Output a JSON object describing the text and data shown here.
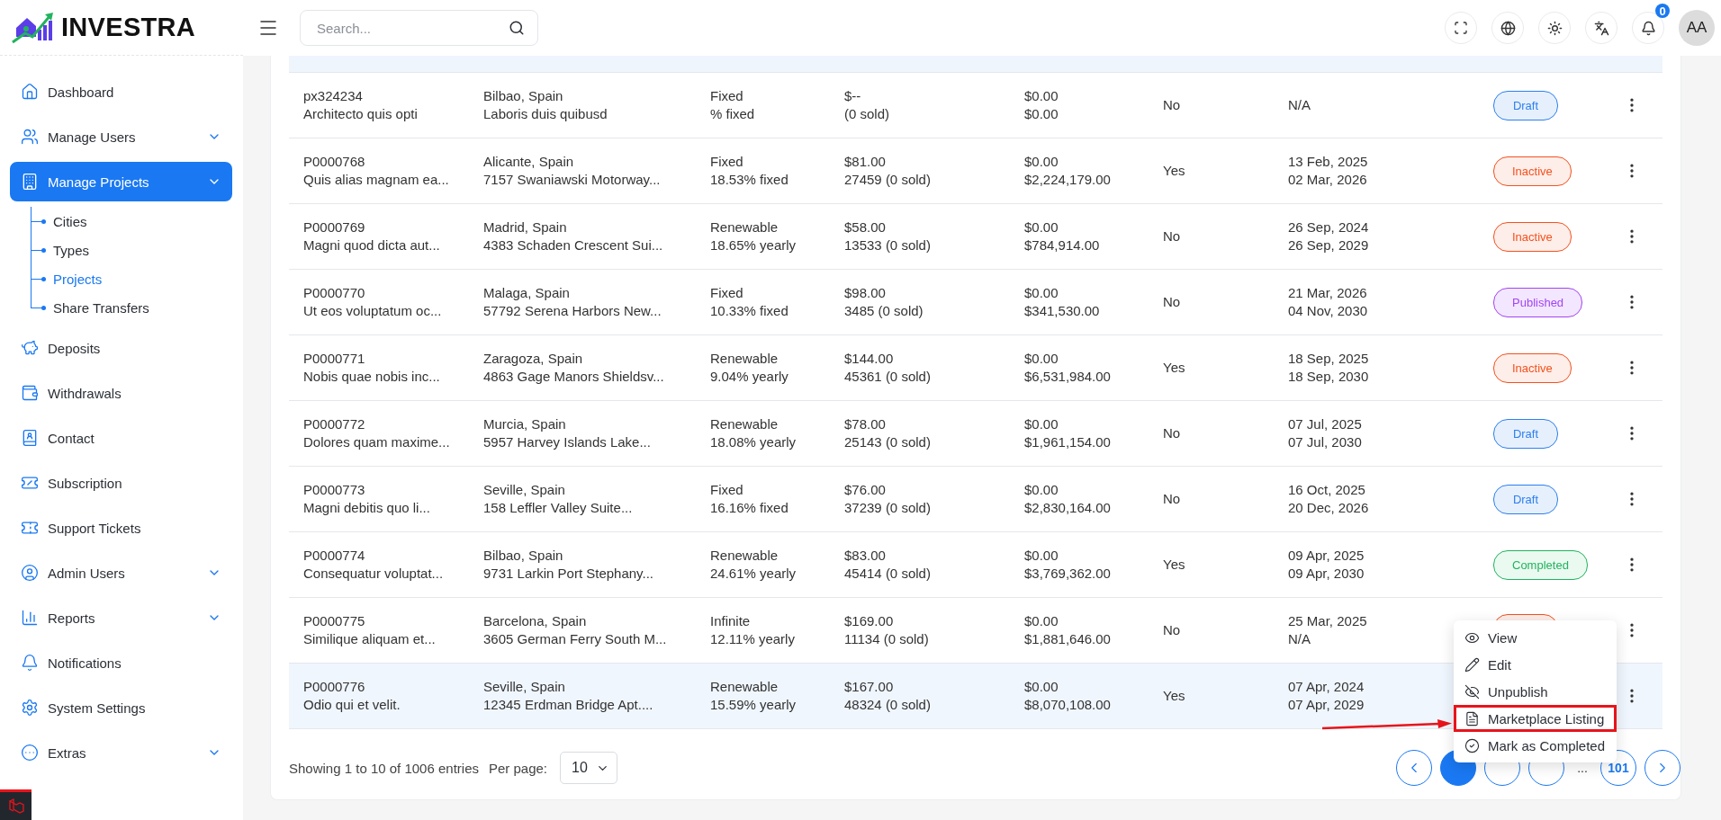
{
  "brand": {
    "name": "INVESTRA"
  },
  "search": {
    "placeholder": "Search..."
  },
  "notifications": {
    "count": "0"
  },
  "user": {
    "initials": "AA"
  },
  "sidebar": {
    "items": [
      {
        "label": "Dashboard",
        "has_submenu": false,
        "selected": false
      },
      {
        "label": "Manage Users",
        "has_submenu": true,
        "selected": false
      },
      {
        "label": "Manage Projects",
        "has_submenu": true,
        "selected": true,
        "children": [
          {
            "label": "Cities",
            "selected": false
          },
          {
            "label": "Types",
            "selected": false
          },
          {
            "label": "Projects",
            "selected": true
          },
          {
            "label": "Share Transfers",
            "selected": false
          }
        ]
      },
      {
        "label": "Deposits",
        "has_submenu": false,
        "selected": false
      },
      {
        "label": "Withdrawals",
        "has_submenu": false,
        "selected": false
      },
      {
        "label": "Contact",
        "has_submenu": false,
        "selected": false
      },
      {
        "label": "Subscription",
        "has_submenu": false,
        "selected": false
      },
      {
        "label": "Support Tickets",
        "has_submenu": false,
        "selected": false
      },
      {
        "label": "Admin Users",
        "has_submenu": true,
        "selected": false
      },
      {
        "label": "Reports",
        "has_submenu": true,
        "selected": false
      },
      {
        "label": "Notifications",
        "has_submenu": false,
        "selected": false
      },
      {
        "label": "System Settings",
        "has_submenu": false,
        "selected": false
      },
      {
        "label": "Extras",
        "has_submenu": true,
        "selected": false
      }
    ]
  },
  "table": {
    "rows": [
      {
        "highlighted": false,
        "cells": [
          [
            "px324234",
            "Architecto quis opti"
          ],
          [
            "Bilbao, Spain",
            "Laboris duis quibusd"
          ],
          [
            "Fixed",
            "% fixed"
          ],
          [
            "$--",
            "(0 sold)"
          ],
          [
            "$0.00",
            "$0.00"
          ],
          [
            "No"
          ],
          [
            "N/A"
          ]
        ],
        "status": {
          "kind": "draft",
          "label": "Draft"
        }
      },
      {
        "highlighted": false,
        "cells": [
          [
            "P0000768",
            "Quis alias magnam ea..."
          ],
          [
            "Alicante, Spain",
            "7157 Swaniawski Motorway..."
          ],
          [
            "Fixed",
            "18.53% fixed"
          ],
          [
            "$81.00",
            "27459 (0 sold)"
          ],
          [
            "$0.00",
            "$2,224,179.00"
          ],
          [
            "Yes"
          ],
          [
            "13 Feb, 2025",
            "02 Mar, 2026"
          ]
        ],
        "status": {
          "kind": "inactive",
          "label": "Inactive"
        }
      },
      {
        "highlighted": false,
        "cells": [
          [
            "P0000769",
            "Magni quod dicta aut..."
          ],
          [
            "Madrid, Spain",
            "4383 Schaden Crescent Sui..."
          ],
          [
            "Renewable",
            "18.65% yearly"
          ],
          [
            "$58.00",
            "13533 (0 sold)"
          ],
          [
            "$0.00",
            "$784,914.00"
          ],
          [
            "No"
          ],
          [
            "26 Sep, 2024",
            "26 Sep, 2029"
          ]
        ],
        "status": {
          "kind": "inactive",
          "label": "Inactive"
        }
      },
      {
        "highlighted": false,
        "cells": [
          [
            "P0000770",
            "Ut eos voluptatum oc..."
          ],
          [
            "Malaga, Spain",
            "57792 Serena Harbors New..."
          ],
          [
            "Fixed",
            "10.33% fixed"
          ],
          [
            "$98.00",
            "3485 (0 sold)"
          ],
          [
            "$0.00",
            "$341,530.00"
          ],
          [
            "No"
          ],
          [
            "21 Mar, 2026",
            "04 Nov, 2030"
          ]
        ],
        "status": {
          "kind": "published",
          "label": "Published"
        }
      },
      {
        "highlighted": false,
        "cells": [
          [
            "P0000771",
            "Nobis quae nobis inc..."
          ],
          [
            "Zaragoza, Spain",
            "4863 Gage Manors Shieldsv..."
          ],
          [
            "Renewable",
            "9.04% yearly"
          ],
          [
            "$144.00",
            "45361 (0 sold)"
          ],
          [
            "$0.00",
            "$6,531,984.00"
          ],
          [
            "Yes"
          ],
          [
            "18 Sep, 2025",
            "18 Sep, 2030"
          ]
        ],
        "status": {
          "kind": "inactive",
          "label": "Inactive"
        }
      },
      {
        "highlighted": false,
        "cells": [
          [
            "P0000772",
            "Dolores quam maxime..."
          ],
          [
            "Murcia, Spain",
            "5957 Harvey Islands Lake..."
          ],
          [
            "Renewable",
            "18.08% yearly"
          ],
          [
            "$78.00",
            "25143 (0 sold)"
          ],
          [
            "$0.00",
            "$1,961,154.00"
          ],
          [
            "No"
          ],
          [
            "07 Jul, 2025",
            "07 Jul, 2030"
          ]
        ],
        "status": {
          "kind": "draft",
          "label": "Draft"
        }
      },
      {
        "highlighted": false,
        "cells": [
          [
            "P0000773",
            "Magni debitis quo li..."
          ],
          [
            "Seville, Spain",
            "158 Leffler Valley Suite..."
          ],
          [
            "Fixed",
            "16.16% fixed"
          ],
          [
            "$76.00",
            "37239 (0 sold)"
          ],
          [
            "$0.00",
            "$2,830,164.00"
          ],
          [
            "No"
          ],
          [
            "16 Oct, 2025",
            "20 Dec, 2026"
          ]
        ],
        "status": {
          "kind": "draft",
          "label": "Draft"
        }
      },
      {
        "highlighted": false,
        "cells": [
          [
            "P0000774",
            "Consequatur voluptat..."
          ],
          [
            "Bilbao, Spain",
            "9731 Larkin Port Stephany..."
          ],
          [
            "Renewable",
            "24.61% yearly"
          ],
          [
            "$83.00",
            "45414 (0 sold)"
          ],
          [
            "$0.00",
            "$3,769,362.00"
          ],
          [
            "Yes"
          ],
          [
            "09 Apr, 2025",
            "09 Apr, 2030"
          ]
        ],
        "status": {
          "kind": "completed",
          "label": "Completed"
        }
      },
      {
        "highlighted": false,
        "cells": [
          [
            "P0000775",
            "Similique aliquam et..."
          ],
          [
            "Barcelona, Spain",
            "3605 German Ferry South M..."
          ],
          [
            "Infinite",
            "12.11% yearly"
          ],
          [
            "$169.00",
            "11134 (0 sold)"
          ],
          [
            "$0.00",
            "$1,881,646.00"
          ],
          [
            "No"
          ],
          [
            "25 Mar, 2025",
            "N/A"
          ]
        ],
        "status": {
          "kind": "inactive"
        }
      },
      {
        "highlighted": true,
        "cells": [
          [
            "P0000776",
            "Odio qui et velit."
          ],
          [
            "Seville, Spain",
            "12345 Erdman Bridge Apt...."
          ],
          [
            "Renewable",
            "15.59% yearly"
          ],
          [
            "$167.00",
            "48324 (0 sold)"
          ],
          [
            "$0.00",
            "$8,070,108.00"
          ],
          [
            "Yes"
          ],
          [
            "07 Apr, 2024",
            "07 Apr, 2029"
          ]
        ]
      }
    ]
  },
  "footer": {
    "summary": "Showing 1 to 10 of 1006 entries",
    "per_page_label": "Per page:",
    "per_page": "10"
  },
  "pagination": {
    "pages": [
      {
        "kind": "page",
        "selected": true
      },
      {
        "kind": "page",
        "selected": false
      },
      {
        "kind": "page",
        "selected": false
      },
      {
        "kind": "gap",
        "label": "..."
      },
      {
        "kind": "page",
        "label": "101",
        "selected": false
      }
    ]
  },
  "action_menu": {
    "items": [
      {
        "label": "View",
        "annotated": false
      },
      {
        "label": "Edit",
        "annotated": false
      },
      {
        "label": "Unpublish",
        "annotated": false
      },
      {
        "label": "Marketplace Listing",
        "annotated": true
      },
      {
        "label": "Mark as Completed",
        "annotated": false
      }
    ]
  }
}
